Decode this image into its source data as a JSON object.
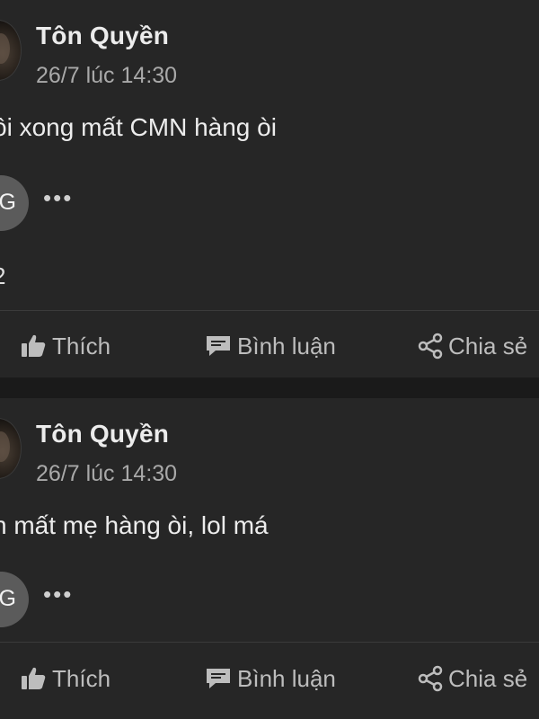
{
  "posts": [
    {
      "author": "Tôn Quyền",
      "timestamp": "26/7 lúc 14:30",
      "text": "ôi xong mất CMN hàng òi",
      "commenter_initial": "G",
      "more_label": "•••",
      "reaction_text": "2",
      "actions": {
        "like": "Thích",
        "comment": "Bình luận",
        "share": "Chia sẻ"
      }
    },
    {
      "author": "Tôn Quyền",
      "timestamp": "26/7 lúc 14:30",
      "text": "n mất mẹ hàng òi, lol má",
      "commenter_initial": "G",
      "more_label": "•••",
      "actions": {
        "like": "Thích",
        "comment": "Bình luận",
        "share": "Chia sẻ"
      }
    }
  ]
}
